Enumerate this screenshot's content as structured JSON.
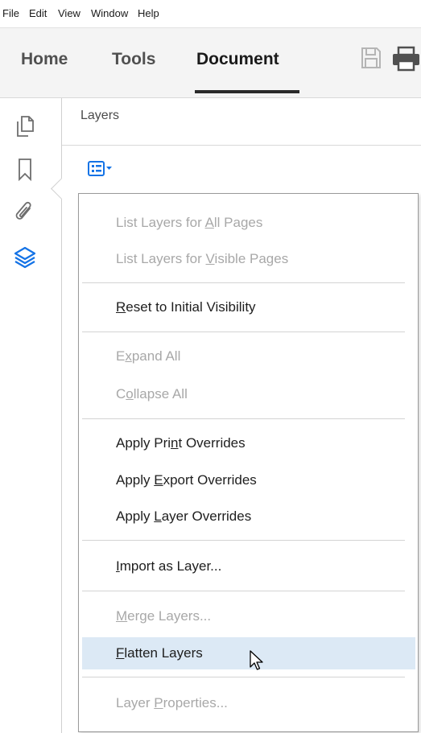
{
  "menubar": {
    "items": [
      "File",
      "Edit",
      "View",
      "Window",
      "Help"
    ]
  },
  "tabs": [
    {
      "label": "Home"
    },
    {
      "label": "Tools"
    },
    {
      "label": "Document",
      "active": true
    }
  ],
  "toolbar_icons": [
    "save-icon",
    "print-icon"
  ],
  "rail_icons": [
    "page-thumbnails-icon",
    "bookmark-icon",
    "attachment-icon",
    "layers-icon"
  ],
  "panel": {
    "title": "Layers",
    "options_icon": "list-options-icon"
  },
  "menu": {
    "items": [
      {
        "pre": "List Layers for ",
        "u": "A",
        "post": "ll Pages",
        "enabled": false
      },
      {
        "pre": "List Layers for ",
        "u": "V",
        "post": "isible Pages",
        "enabled": false
      },
      {
        "pre": "",
        "u": "R",
        "post": "eset to Initial Visibility",
        "enabled": true
      },
      {
        "pre": "E",
        "u": "x",
        "post": "pand All",
        "enabled": false
      },
      {
        "pre": "C",
        "u": "o",
        "post": "llapse All",
        "enabled": false
      },
      {
        "pre": "Apply Pri",
        "u": "n",
        "post": "t Overrides",
        "enabled": true
      },
      {
        "pre": "Apply ",
        "u": "E",
        "post": "xport Overrides",
        "enabled": true
      },
      {
        "pre": "Apply ",
        "u": "L",
        "post": "ayer Overrides",
        "enabled": true
      },
      {
        "pre": "",
        "u": "I",
        "post": "mport as Layer...",
        "enabled": true
      },
      {
        "pre": "",
        "u": "M",
        "post": "erge Layers...",
        "enabled": false
      },
      {
        "pre": "",
        "u": "F",
        "post": "latten Layers",
        "enabled": true,
        "hovered": true
      },
      {
        "pre": "Layer ",
        "u": "P",
        "post": "roperties...",
        "enabled": false
      }
    ]
  },
  "colors": {
    "accent": "#1473e6",
    "disabled_text": "#a8a8a8",
    "hover_bg": "#dce9f5"
  }
}
